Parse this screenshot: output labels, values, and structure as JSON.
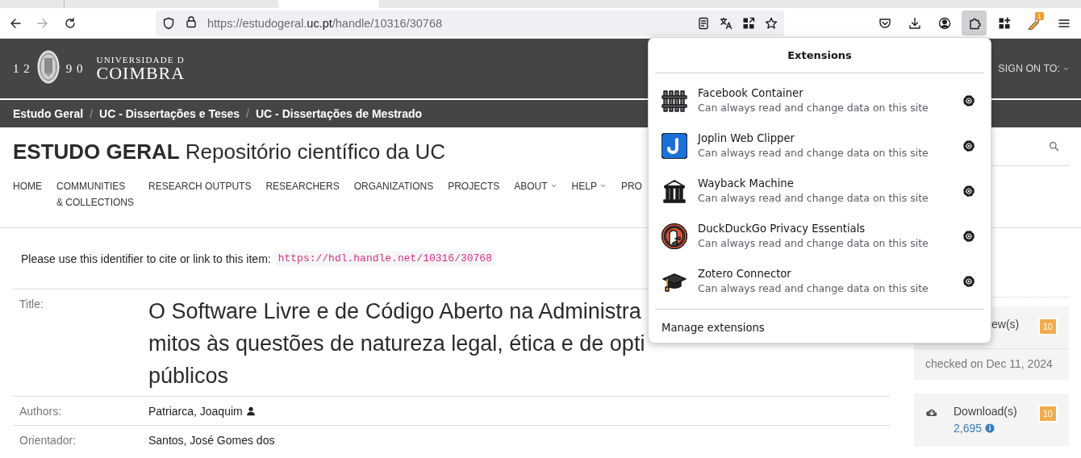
{
  "browser": {
    "nav_buttons": [
      {
        "disabled": false
      },
      {
        "disabled": true
      },
      {
        "disabled": false
      }
    ],
    "address_bar": {
      "url_before": "https://estudogeral.",
      "url_host": "uc.pt",
      "url_after": "/handle/10316/30768"
    },
    "toolbar_buttons": [
      {
        "selected": false
      },
      {
        "selected": false
      },
      {
        "selected": false
      },
      {
        "selected": true
      },
      {
        "selected": false
      },
      {
        "selected": false,
        "badge": "1"
      },
      {
        "selected": false
      }
    ]
  },
  "header": {
    "logo": {
      "year_left": "1 2",
      "year_right": "9 0",
      "line_1": "UNIVERSIDADE D",
      "line_2": "COIMBRA"
    },
    "sign_on": "SIGN ON TO:"
  },
  "breadcrumbs": {
    "separator": "/",
    "items": [
      "Estudo Geral",
      "UC - Dissertações e Teses",
      "UC - Dissertações de Mestrado"
    ]
  },
  "site_title": "**ESTUDO GERAL** Repositório científico da UC",
  "nav": [
    {
      "label": "HOME",
      "dropdown": false
    },
    {
      "label": "COMMUNITIES\n& COLLECTIONS",
      "dropdown": false
    },
    {
      "label": "RESEARCH OUTPUTS",
      "dropdown": false
    },
    {
      "label": "RESEARCHERS",
      "dropdown": false
    },
    {
      "label": "ORGANIZATIONS",
      "dropdown": false
    },
    {
      "label": "PROJECTS",
      "dropdown": false
    },
    {
      "label": "ABOUT",
      "dropdown": true
    },
    {
      "label": "HELP",
      "dropdown": true
    },
    {
      "label": "PRO",
      "dropdown": false
    }
  ],
  "identifier": {
    "text": "Please use this identifier to cite or link to this item:",
    "link": "https://hdl.handle.net/10316/30768"
  },
  "fields": [
    {
      "label": "Title:",
      "kind": "title",
      "lines": [
        "O Software Livre e de Código Aberto na Administra",
        "mitos às questões de natureza legal, ética e de opti",
        "públicos"
      ]
    },
    {
      "label": "Authors:",
      "kind": "person",
      "value": "Patriarca, Joaquim"
    },
    {
      "label": "Orientador:",
      "kind": "plain",
      "value": "Santos, José Gomes dos"
    }
  ],
  "stats": [
    {
      "kind": "views",
      "label": "ew(s)",
      "badge": "10",
      "note": "checked on Dec 11, 2024"
    },
    {
      "kind": "downloads",
      "label": "Download(s)",
      "count": "2,695",
      "badge": "10"
    }
  ],
  "extensions_popup": {
    "title": "Extensions",
    "items": [
      {
        "name": "Facebook Container",
        "description": "Can always read and change data on this site"
      },
      {
        "name": "Joplin Web Clipper",
        "description": "Can always read and change data on this site"
      },
      {
        "name": "Wayback Machine",
        "description": "Can always read and change data on this site"
      },
      {
        "name": "DuckDuckGo Privacy Essentials",
        "description": "Can always read and change data on this site"
      },
      {
        "name": "Zotero Connector",
        "description": "Can always read and change data on this site"
      }
    ],
    "footer": "Manage extensions"
  }
}
